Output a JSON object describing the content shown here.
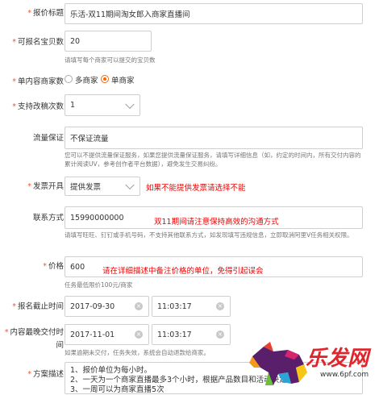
{
  "form": {
    "title_label": "报价标题",
    "title_value": "乐活-双11期间淘女郎入商家直播间",
    "count_label": "可报名宝贝数",
    "count_value": "20",
    "count_hint": "请填写每个商家可以提交的宝贝数",
    "merchant_label": "单内容商家数",
    "merchant_opt1": "多商家",
    "merchant_opt2": "单商家",
    "revisions_label": "支持改稿次数",
    "revisions_value": "1",
    "guarantee_label": "流量保证",
    "guarantee_value": "不保证流量",
    "guarantee_hint": "您可以不提供流量保证服务，如果您提供流量保证服务，请填写详细信息（如，约定的时间内，所有交付内容的累计阅读UV，参考创作者平台数据），避免发生交易纠纷。",
    "invoice_label": "发票开具",
    "invoice_value": "提供发票",
    "invoice_note": "如果不能提供发票请选择不能",
    "contact_label": "联系方式",
    "contact_value": "15990000000",
    "contact_note": "双11期间请注意保持高效的沟通方式",
    "contact_hint": "请填写旺旺、钉钉或手机号码，不支持其他联系方式，如发现填写违规信息，立即取消阿里V任务相关权限。",
    "price_label": "价格",
    "price_value": "600",
    "price_note": "请在详细描述中备注价格的单位，免得引起误会",
    "price_hint": "任务最低限价100元/商家",
    "deadline_label": "报名截止时间",
    "deadline_date": "2017-09-30",
    "deadline_time": "11:03:17",
    "delivery_label_1": "内容最晚交付时",
    "delivery_label_2": "间",
    "delivery_date": "2017-11-01",
    "delivery_time": "11:03:17",
    "delivery_hint": "如果逾期未交付，任务失效，系统会自动退款给商家。",
    "plan_label": "方案描述",
    "plan_line1": "1、报价单位为每小时。",
    "plan_line2": "2、一天为一个商家直播最多3个小时，根据产品数目和活动决定",
    "plan_line3": "3、一周可以为商家直播5次"
  },
  "watermark": {
    "brand": "乐发网",
    "url": "www.6pf.com"
  }
}
